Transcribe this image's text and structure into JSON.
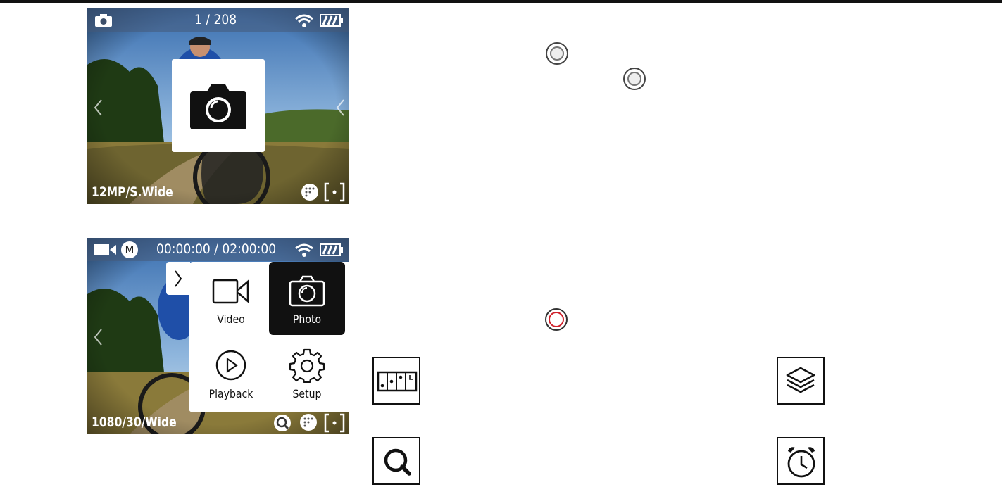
{
  "screen1": {
    "status": {
      "counter": "1 / 208"
    },
    "bottom_label": "12MP/S.Wide",
    "icons": [
      "camera-mode-icon",
      "wifi-icon",
      "battery-icon",
      "photo-popup-camera-icon",
      "color-mode-icon",
      "metering-icon"
    ]
  },
  "screen2": {
    "status": {
      "mode_badge": "M",
      "timecode": "00:00:00 / 02:00:00"
    },
    "bottom_label": "1080/30/Wide",
    "menu": {
      "items": [
        {
          "label": "Video",
          "icon": "video-camera-icon",
          "selected": false
        },
        {
          "label": "Photo",
          "icon": "photo-camera-icon",
          "selected": true
        },
        {
          "label": "Playback",
          "icon": "play-icon",
          "selected": false
        },
        {
          "label": "Setup",
          "icon": "gear-icon",
          "selected": false
        }
      ]
    },
    "icons": [
      "video-mode-icon",
      "wifi-icon",
      "battery-icon",
      "zoom-icon",
      "color-mode-icon",
      "metering-icon"
    ]
  },
  "accent_colors": {
    "record_ring": "#d0202a",
    "selected_menu": "#111111"
  }
}
